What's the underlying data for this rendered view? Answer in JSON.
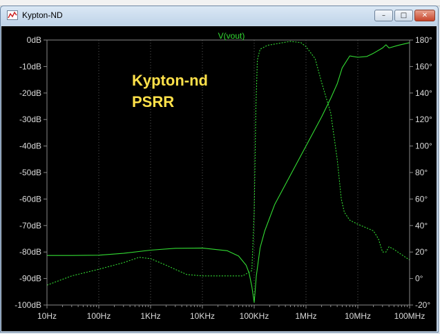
{
  "window": {
    "title": "Kypton-ND",
    "minimize_glyph": "–",
    "maximize_glyph": "□",
    "close_glyph": "✕",
    "app_icon": "waveform-chart-icon"
  },
  "colors": {
    "background": "#000000",
    "trace": "#33dd33",
    "frame": "#8a8a8a",
    "axis_text": "#dcdcdc",
    "annotation": "#ffe14a",
    "grid": "#5a5a5a"
  },
  "chart_data": {
    "type": "line",
    "title": "V(vout)",
    "annotation": [
      "Kypton-nd",
      "PSRR"
    ],
    "x_scale": "log",
    "xlim": [
      10,
      100000000
    ],
    "x_ticks": [
      {
        "value": 10,
        "label": "10Hz"
      },
      {
        "value": 100,
        "label": "100Hz"
      },
      {
        "value": 1000,
        "label": "1KHz"
      },
      {
        "value": 10000,
        "label": "10KHz"
      },
      {
        "value": 100000,
        "label": "100KHz"
      },
      {
        "value": 1000000,
        "label": "1MHz"
      },
      {
        "value": 10000000,
        "label": "10MHz"
      },
      {
        "value": 100000000,
        "label": "100MHz"
      }
    ],
    "y_left": {
      "unit": "dB",
      "lim": [
        -100,
        0
      ],
      "ticks": [
        {
          "value": 0,
          "label": "0dB"
        },
        {
          "value": -10,
          "label": "-10dB"
        },
        {
          "value": -20,
          "label": "-20dB"
        },
        {
          "value": -30,
          "label": "-30dB"
        },
        {
          "value": -40,
          "label": "-40dB"
        },
        {
          "value": -50,
          "label": "-50dB"
        },
        {
          "value": -60,
          "label": "-60dB"
        },
        {
          "value": -70,
          "label": "-70dB"
        },
        {
          "value": -80,
          "label": "-80dB"
        },
        {
          "value": -90,
          "label": "-90dB"
        },
        {
          "value": -100,
          "label": "-100dB"
        }
      ]
    },
    "y_right": {
      "unit": "degrees",
      "lim": [
        -20,
        180
      ],
      "ticks": [
        {
          "value": 180,
          "label": "180°"
        },
        {
          "value": 160,
          "label": "160°"
        },
        {
          "value": 140,
          "label": "140°"
        },
        {
          "value": 120,
          "label": "120°"
        },
        {
          "value": 100,
          "label": "100°"
        },
        {
          "value": 80,
          "label": "80°"
        },
        {
          "value": 60,
          "label": "60°"
        },
        {
          "value": 40,
          "label": "40°"
        },
        {
          "value": 20,
          "label": "20°"
        },
        {
          "value": 0,
          "label": "0°"
        },
        {
          "value": -20,
          "label": "-20°"
        }
      ]
    },
    "series": [
      {
        "axis": "left",
        "style": "solid",
        "x": [
          10,
          30,
          100,
          300,
          1000,
          3000,
          10000,
          30000,
          50000,
          70000,
          80000,
          90000,
          100000,
          105000,
          110000,
          130000,
          160000,
          250000,
          1000000,
          2000000,
          3000000,
          4000000,
          5000000,
          7000000,
          10000000,
          15000000,
          20000000,
          30000000,
          35000000,
          40000000,
          60000000,
          100000000
        ],
        "y": [
          -81.3,
          -81.3,
          -81.2,
          -80.5,
          -79.3,
          -78.6,
          -78.5,
          -79.5,
          -81.5,
          -85,
          -88,
          -93,
          -99,
          -94,
          -89,
          -78.5,
          -72,
          -62,
          -40,
          -29,
          -22,
          -16.5,
          -10.5,
          -6,
          -6.5,
          -6.2,
          -5,
          -3,
          -1.8,
          -3,
          -2,
          -1
        ]
      },
      {
        "axis": "right",
        "style": "dashed",
        "x": [
          10,
          30,
          100,
          300,
          600,
          1000,
          2000,
          5000,
          10000,
          30000,
          60000,
          90000,
          100000,
          108000,
          115000,
          130000,
          180000,
          500000,
          800000,
          1000000,
          1500000,
          2000000,
          3000000,
          4000000,
          4800000,
          5500000,
          7000000,
          10000000,
          20000000,
          25000000,
          30000000,
          35000000,
          40000000,
          50000000,
          70000000,
          100000000
        ],
        "y": [
          -5,
          2,
          7,
          12,
          16,
          15,
          10,
          3,
          2,
          2,
          2,
          6,
          50,
          130,
          165,
          173,
          176,
          179,
          178,
          175,
          166,
          148,
          125,
          90,
          60,
          50,
          44,
          41,
          36,
          30,
          20,
          20,
          24,
          22,
          18,
          14
        ]
      }
    ]
  }
}
